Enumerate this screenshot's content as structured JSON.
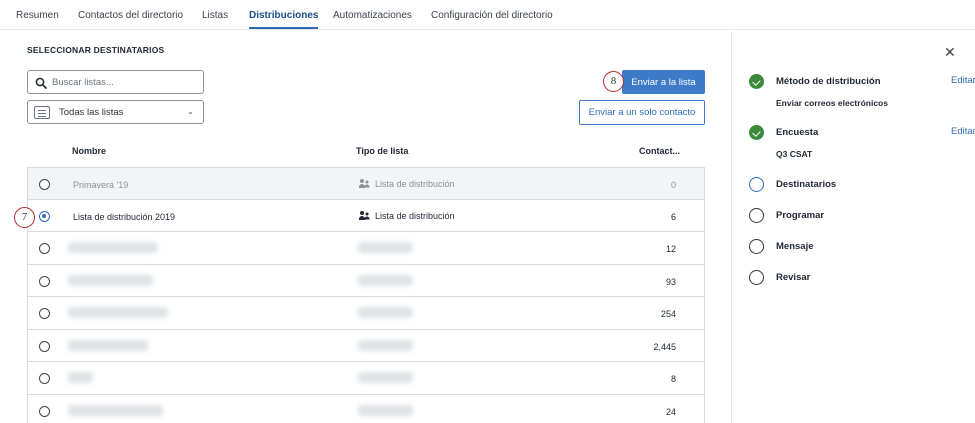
{
  "nav": {
    "tabs": [
      {
        "label": "Resumen",
        "active": false
      },
      {
        "label": "Contactos del directorio",
        "active": false
      },
      {
        "label": "Listas",
        "active": false
      },
      {
        "label": "Distribuciones",
        "active": true
      },
      {
        "label": "Automatizaciones",
        "active": false
      },
      {
        "label": "Configuración del directorio",
        "active": false
      }
    ]
  },
  "main": {
    "section_title": "SELECCIONAR DESTINATARIOS",
    "search_placeholder": "Buscar listas...",
    "filter_selected": "Todas las listas",
    "send_to_list_button": "Enviar a la lista",
    "send_single_button": "Enviar a un solo contacto",
    "columns": {
      "name": "Nombre",
      "type": "Tipo de lista",
      "contacts": "Contact..."
    },
    "rows": [
      {
        "name": "Primavera '19",
        "type": "Lista de distribución",
        "count": "0",
        "state": "disabled"
      },
      {
        "name": "Lista de distribución 2019",
        "type": "Lista de distribución",
        "count": "6",
        "state": "selected"
      },
      {
        "name": "",
        "type": "",
        "count": "12",
        "state": "blurred"
      },
      {
        "name": "",
        "type": "",
        "count": "93",
        "state": "blurred"
      },
      {
        "name": "",
        "type": "",
        "count": "254",
        "state": "blurred"
      },
      {
        "name": "",
        "type": "",
        "count": "2,445",
        "state": "blurred"
      },
      {
        "name": "",
        "type": "",
        "count": "8",
        "state": "blurred"
      },
      {
        "name": "",
        "type": "",
        "count": "24",
        "state": "blurred"
      }
    ]
  },
  "callouts": {
    "radio": "7",
    "send": "8"
  },
  "sidebar": {
    "steps": [
      {
        "label": "Método de distribución",
        "sub": "Enviar correos electrónicos",
        "status": "done",
        "edit": "Editar"
      },
      {
        "label": "Encuesta",
        "sub": "Q3 CSAT",
        "status": "done",
        "edit": "Editar"
      },
      {
        "label": "Destinatarios",
        "sub": "",
        "status": "current",
        "edit": ""
      },
      {
        "label": "Programar",
        "sub": "",
        "status": "pending",
        "edit": ""
      },
      {
        "label": "Mensaje",
        "sub": "",
        "status": "pending",
        "edit": ""
      },
      {
        "label": "Revisar",
        "sub": "",
        "status": "pending",
        "edit": ""
      }
    ]
  },
  "colors": {
    "accent": "#3d7bc9",
    "success": "#3a8a3a",
    "callout_border": "#b02a30"
  }
}
